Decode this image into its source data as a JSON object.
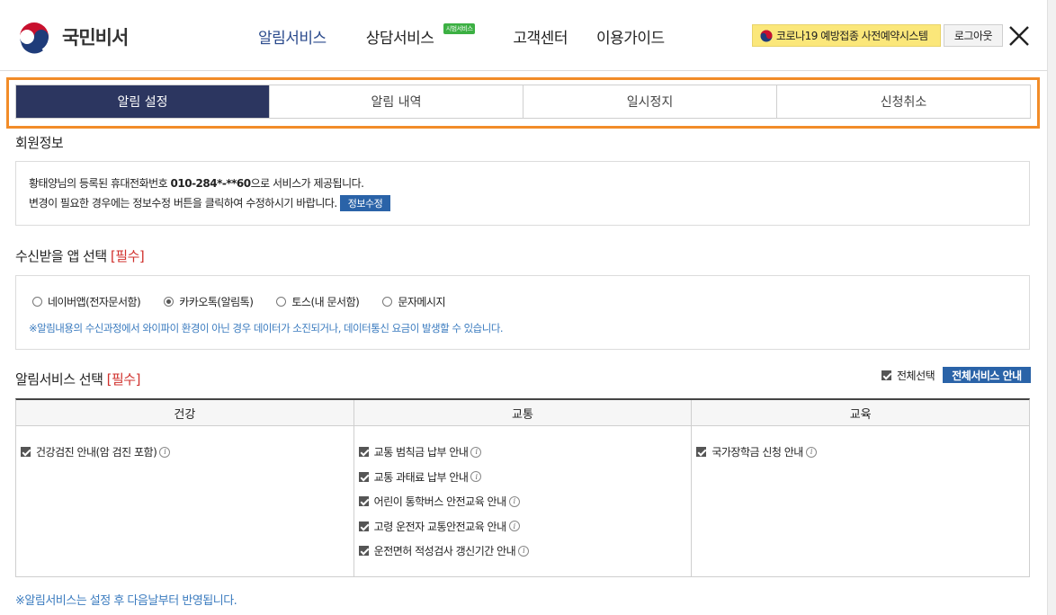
{
  "header": {
    "logo_text": "국민비서",
    "nav": [
      {
        "label": "알림서비스"
      },
      {
        "label": "상담서비스",
        "badge": "시범서비스"
      },
      {
        "label": "고객센터"
      },
      {
        "label": "이용가이드"
      }
    ],
    "covid_label": "코로나19 예방접종 사전예약시스템",
    "logout_label": "로그아웃"
  },
  "tabs": [
    "알림 설정",
    "알림 내역",
    "일시정지",
    "신청취소"
  ],
  "member": {
    "title": "회원정보",
    "line1_prefix": "황태양님의 등록된 휴대전화번호 ",
    "phone": "010-284*-**60",
    "line1_suffix": "으로 서비스가 제공됩니다.",
    "line2": "변경이 필요한 경우에는 정보수정 버튼을 클릭하여 수정하시기 바랍니다.",
    "edit_label": "정보수정"
  },
  "app_select": {
    "title": "수신받을 앱 선택",
    "required": "[필수]",
    "options": [
      "네이버앱(전자문서함)",
      "카카오톡(알림톡)",
      "토스(내 문서함)",
      "문자메시지"
    ],
    "selected_index": 1,
    "notice": "※알림내용의 수신과정에서 와이파이 환경이 아닌 경우 데이터가 소진되거나, 데이터통신 요금이 발생할 수 있습니다."
  },
  "service_select": {
    "title": "알림서비스 선택",
    "required": "[필수]",
    "select_all_label": "전체선택",
    "guide_label": "전체서비스 안내",
    "columns": [
      {
        "header": "건강",
        "items": [
          "건강검진 안내(암 검진 포함)"
        ]
      },
      {
        "header": "교통",
        "items": [
          "교통 범칙금 납부 안내",
          "교통 과태료 납부 안내",
          "어린이 통학버스 안전교육 안내",
          "고령 운전자 교통안전교육 안내",
          "운전면허 적성검사 갱신기간 안내"
        ]
      },
      {
        "header": "교육",
        "items": [
          "국가장학금 신청 안내"
        ]
      }
    ]
  },
  "bottom_note": "※알림서비스는 설정 후 다음날부터 반영됩니다.",
  "colors": {
    "accent": "#2c3660",
    "highlight": "#f28c28",
    "button_blue": "#2a63a8",
    "covid_yellow": "#fbe77a"
  }
}
